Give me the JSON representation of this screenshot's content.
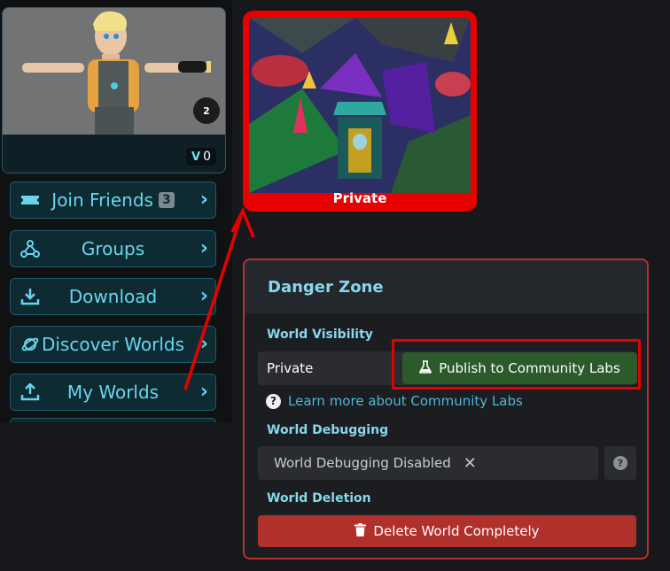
{
  "avatar": {
    "badge": "2",
    "count": "0",
    "count_icon": "vrc-plus-icon"
  },
  "nav": {
    "items": [
      {
        "label": "Join Friends",
        "icon": "ticket-icon",
        "count": "3"
      },
      {
        "label": "Groups",
        "icon": "groups-icon"
      },
      {
        "label": "Download",
        "icon": "download-icon"
      },
      {
        "label": "Discover Worlds",
        "icon": "planet-icon"
      },
      {
        "label": "My Worlds",
        "icon": "upload-icon"
      }
    ]
  },
  "world": {
    "visibility_label": "Private"
  },
  "danger_zone": {
    "title": "Danger Zone",
    "visibility": {
      "label": "World Visibility",
      "value": "Private",
      "publish_button": "Publish to Community Labs",
      "learn_more": "Learn more about Community Labs"
    },
    "debugging": {
      "label": "World Debugging",
      "value": "World Debugging Disabled"
    },
    "deletion": {
      "label": "World Deletion",
      "button": "Delete World Completely"
    }
  },
  "colors": {
    "accent": "#67d6ec",
    "highlight": "#e80000",
    "publish": "#2d5a2a",
    "delete": "#b0302c"
  }
}
